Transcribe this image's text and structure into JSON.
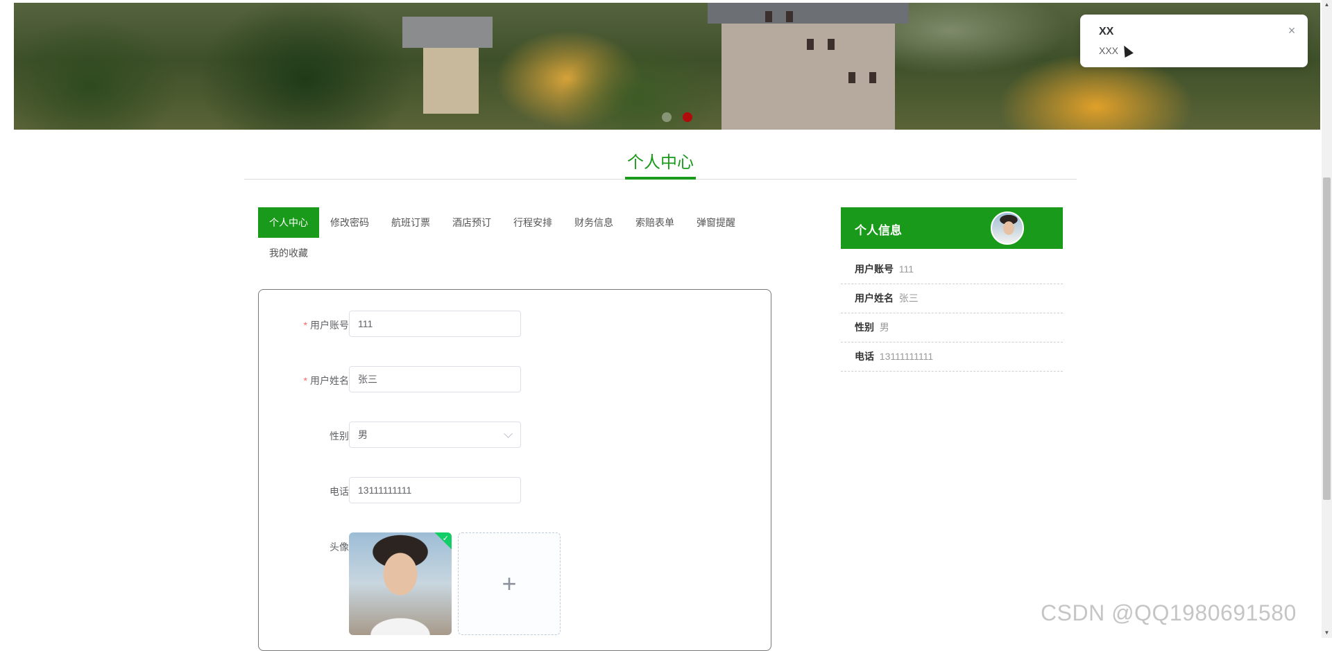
{
  "banner": {
    "slide_count": 2,
    "active_slide": 2
  },
  "notification": {
    "title": "XX",
    "message": "XXX",
    "close_icon": "×"
  },
  "section": {
    "title": "个人中心"
  },
  "tabs": [
    {
      "label": "个人中心",
      "active": true
    },
    {
      "label": "修改密码"
    },
    {
      "label": "航班订票"
    },
    {
      "label": "酒店预订"
    },
    {
      "label": "行程安排"
    },
    {
      "label": "财务信息"
    },
    {
      "label": "索赔表单"
    },
    {
      "label": "弹窗提醒"
    },
    {
      "label": "我的收藏"
    }
  ],
  "form": {
    "required_mark": "*",
    "account": {
      "label": "用户账号",
      "value": "111"
    },
    "name": {
      "label": "用户姓名",
      "value": "张三"
    },
    "gender": {
      "label": "性别",
      "value": "男",
      "icon": "chevron-down-icon"
    },
    "phone": {
      "label": "电话",
      "value": "13111111111"
    },
    "avatar": {
      "label": "头像",
      "check_icon": "✓",
      "upload_icon": "+"
    }
  },
  "profile": {
    "title": "个人信息",
    "rows": [
      {
        "key": "用户账号",
        "value": "111"
      },
      {
        "key": "用户姓名",
        "value": "张三"
      },
      {
        "key": "性别",
        "value": "男"
      },
      {
        "key": "电话",
        "value": "13111111111"
      }
    ]
  },
  "watermark": "CSDN @QQ1980691580",
  "scrollbar": {
    "up_icon": "▲",
    "down_icon": "▼"
  }
}
